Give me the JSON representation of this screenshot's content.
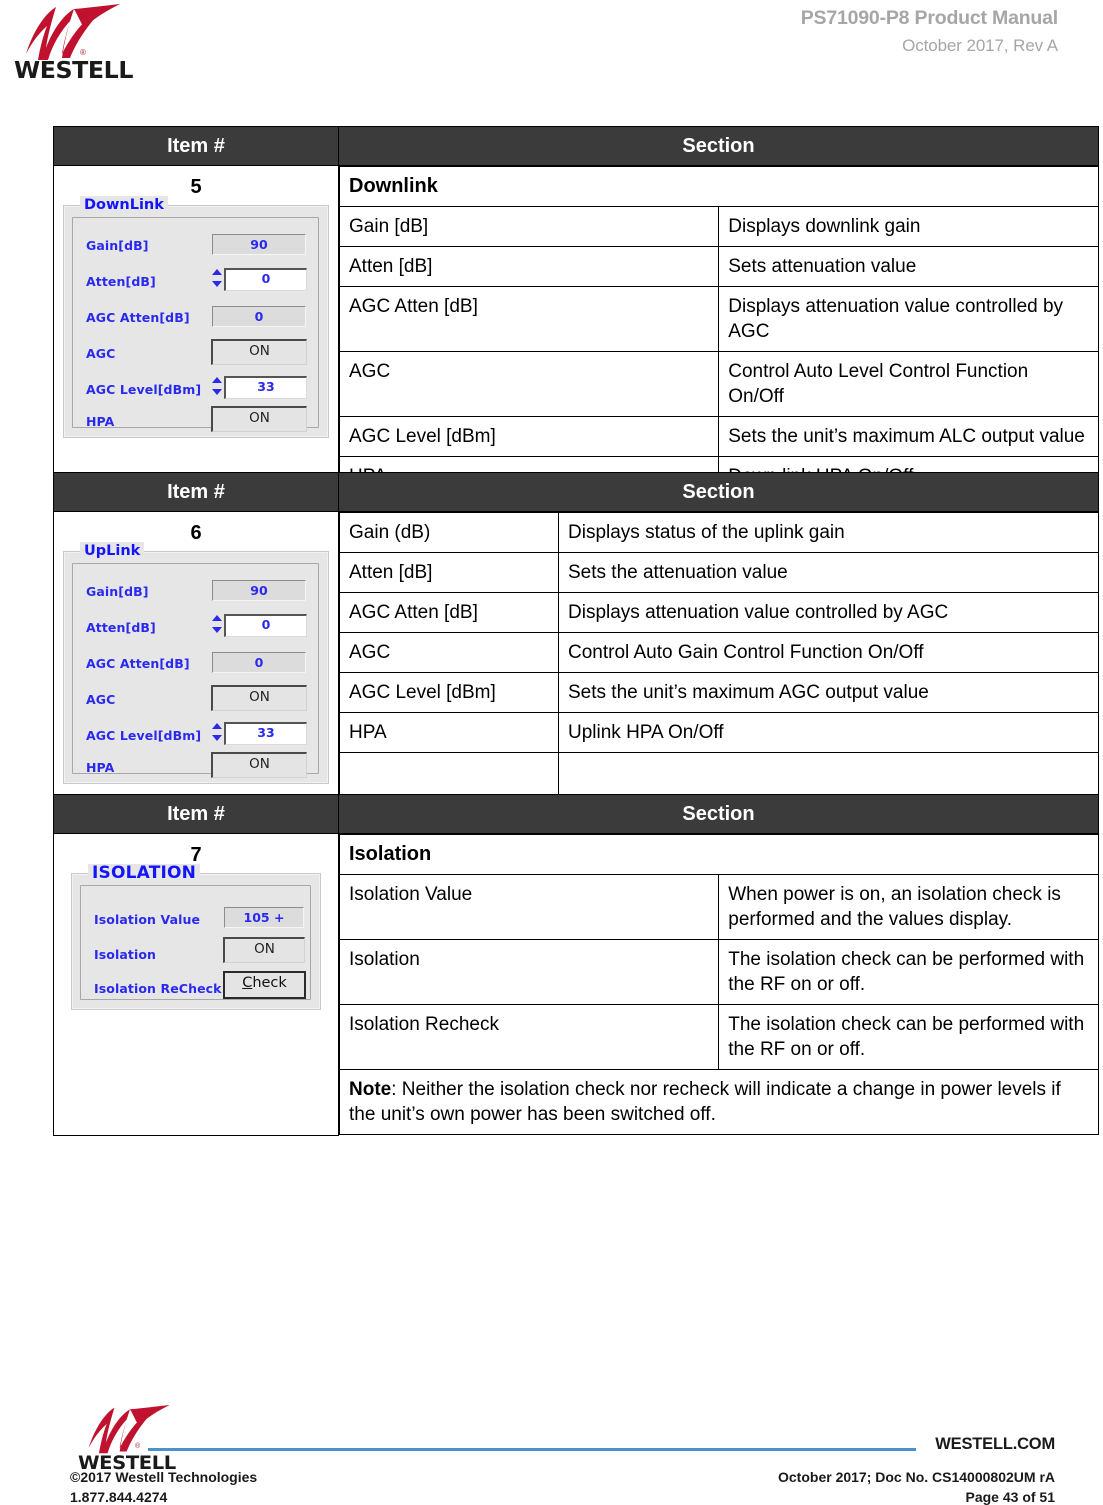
{
  "header": {
    "logo_word": "WESTELL",
    "title": "PS71090-P8 Product Manual",
    "subtitle": "October 2017, Rev A"
  },
  "table_headers": {
    "item": "Item #",
    "section": "Section"
  },
  "sections": [
    {
      "item_number": "5",
      "heading": "Downlink",
      "rows": [
        {
          "name": "Gain [dB]",
          "desc": "Displays downlink gain"
        },
        {
          "name": "Atten [dB]",
          "desc": "Sets attenuation value"
        },
        {
          "name": "AGC Atten [dB]",
          "desc": "Displays attenuation value controlled by AGC"
        },
        {
          "name": "AGC",
          "desc": "Control Auto Level Control Function On/Off"
        },
        {
          "name": "AGC Level [dBm]",
          "desc": "Sets the unit’s maximum ALC output value"
        },
        {
          "name": "HPA",
          "desc": "Down link HPA On/Off"
        },
        {
          "name": "",
          "desc": ""
        }
      ],
      "screenshot": {
        "group_title": "DownLink",
        "fields": [
          {
            "label": "Gain[dB]",
            "value": "90",
            "kind": "readonly"
          },
          {
            "label": "Atten[dB]",
            "value": "0",
            "kind": "spinner"
          },
          {
            "label": "AGC Atten[dB]",
            "value": "0",
            "kind": "readonly"
          },
          {
            "label": "AGC",
            "value": "ON",
            "kind": "button"
          },
          {
            "label": "AGC Level[dBm]",
            "value": "33",
            "kind": "spinner"
          },
          {
            "label": "HPA",
            "value": "ON",
            "kind": "button"
          }
        ]
      }
    },
    {
      "item_number": "6",
      "heading": null,
      "rows": [
        {
          "name": "Gain (dB)",
          "desc": "Displays status of the uplink gain"
        },
        {
          "name": "Atten [dB]",
          "desc": "Sets the attenuation value"
        },
        {
          "name": "AGC Atten [dB]",
          "desc": "Displays attenuation value controlled by AGC"
        },
        {
          "name": "AGC",
          "desc": "Control Auto Gain Control Function On/Off"
        },
        {
          "name": "AGC Level [dBm]",
          "desc": "Sets the unit’s maximum AGC output value"
        },
        {
          "name": "HPA",
          "desc": "Uplink HPA On/Off"
        },
        {
          "name": "",
          "desc": ""
        }
      ],
      "screenshot": {
        "group_title": "UpLink",
        "fields": [
          {
            "label": "Gain[dB]",
            "value": "90",
            "kind": "readonly"
          },
          {
            "label": "Atten[dB]",
            "value": "0",
            "kind": "spinner"
          },
          {
            "label": "AGC Atten[dB]",
            "value": "0",
            "kind": "readonly"
          },
          {
            "label": "AGC",
            "value": "ON",
            "kind": "button"
          },
          {
            "label": "AGC Level[dBm]",
            "value": "33",
            "kind": "spinner"
          },
          {
            "label": "HPA",
            "value": "ON",
            "kind": "button"
          }
        ]
      }
    },
    {
      "item_number": "7",
      "heading": "Isolation",
      "rows": [
        {
          "name": "Isolation Value",
          "desc": "When power is on, an isolation check is performed and the values display."
        },
        {
          "name": "Isolation",
          "desc": "The isolation check can be performed with the RF on or off."
        },
        {
          "name": "Isolation Recheck",
          "desc": "The isolation check can be performed with the RF on or off."
        }
      ],
      "note_label": "Note",
      "note_text": ":  Neither the isolation check nor recheck will indicate a change in power levels if the unit’s own power has been switched off.",
      "screenshot": {
        "group_title": "ISOLATION",
        "fields": [
          {
            "label": "Isolation Value",
            "value": "105 +",
            "kind": "readonly"
          },
          {
            "label": "Isolation",
            "value": "ON",
            "kind": "button"
          },
          {
            "label": "Isolation ReCheck",
            "value": "Check",
            "kind": "check-button"
          }
        ]
      }
    }
  ],
  "footer": {
    "logo_word": "WESTELL",
    "site": "WESTELL.COM",
    "copyright": "©2017 Westell Technologies",
    "phone": "1.877.844.4274",
    "doc_info": "October 2017; Doc No. CS14000802UM rA",
    "page_info": "Page 43 of 51"
  },
  "colors": {
    "header_band": "#3b3b3b",
    "header_text_gray": "#a6a6a6",
    "brand_red": "#c0122f",
    "rule_blue": "#4d90cf",
    "app_label_blue": "#2a2aee"
  }
}
